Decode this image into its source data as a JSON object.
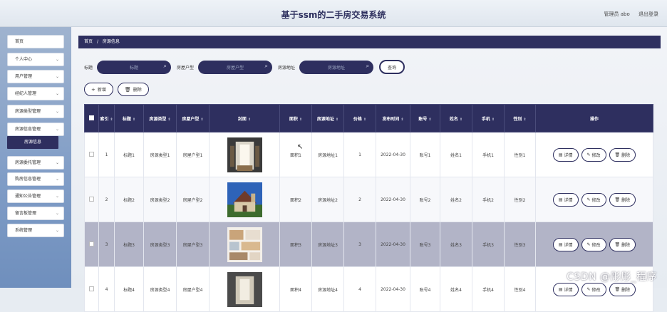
{
  "header": {
    "title": "基于ssm的二手房交易系统",
    "user": "管理员 abo",
    "logout": "退出登录"
  },
  "sidebar": {
    "items": [
      {
        "label": "首页",
        "chevron": false
      },
      {
        "label": "个人中心",
        "chevron": true
      },
      {
        "label": "用户管理",
        "chevron": true
      },
      {
        "label": "经纪人管理",
        "chevron": true
      },
      {
        "label": "房源类型管理",
        "chevron": true
      },
      {
        "label": "房源信息管理",
        "chevron": true
      },
      {
        "label": "房源委托管理",
        "chevron": true
      },
      {
        "label": "购房信息管理",
        "chevron": true
      },
      {
        "label": "通知公告管理",
        "chevron": true
      },
      {
        "label": "留言板管理",
        "chevron": true
      },
      {
        "label": "系统管理",
        "chevron": true
      }
    ],
    "active_sub": "房源信息"
  },
  "breadcrumb": {
    "home": "首页",
    "sep": "/",
    "current": "房源信息"
  },
  "search": {
    "fields": [
      {
        "label": "标题",
        "placeholder": "标题"
      },
      {
        "label": "房屋户型",
        "placeholder": "房屋户型"
      },
      {
        "label": "房源地址",
        "placeholder": "房源地址"
      }
    ],
    "query_button": "查询"
  },
  "actions": {
    "add": "新增",
    "delete": "删除"
  },
  "table": {
    "columns": [
      "索引",
      "标题",
      "房源类型",
      "房屋户型",
      "封面",
      "面积",
      "房源地址",
      "价格",
      "发布时间",
      "账号",
      "姓名",
      "手机",
      "性别",
      "操作"
    ],
    "rows": [
      {
        "index": "1",
        "title": "标题1",
        "type": "房源类型1",
        "layout": "房屋户型1",
        "area": "面积1",
        "address": "房源地址1",
        "price": "1",
        "time": "2022-04-30",
        "account": "账号1",
        "name": "姓名1",
        "phone": "手机1",
        "gender": "性别1"
      },
      {
        "index": "2",
        "title": "标题2",
        "type": "房源类型2",
        "layout": "房屋户型2",
        "area": "面积2",
        "address": "房源地址2",
        "price": "2",
        "time": "2022-04-30",
        "account": "账号2",
        "name": "姓名2",
        "phone": "手机2",
        "gender": "性别2"
      },
      {
        "index": "3",
        "title": "标题3",
        "type": "房源类型3",
        "layout": "房屋户型3",
        "area": "面积3",
        "address": "房源地址3",
        "price": "3",
        "time": "2022-04-30",
        "account": "账号3",
        "name": "姓名3",
        "phone": "手机3",
        "gender": "性别3"
      },
      {
        "index": "4",
        "title": "标题4",
        "type": "房源类型4",
        "layout": "房屋户型4",
        "area": "面积4",
        "address": "房源地址4",
        "price": "4",
        "time": "2022-04-30",
        "account": "账号4",
        "name": "姓名4",
        "phone": "手机4",
        "gender": "性别4"
      }
    ],
    "row_buttons": {
      "detail": "详情",
      "edit": "修改",
      "delete": "删除"
    }
  },
  "watermark": "CSDN @彤彤_程序",
  "colors": {
    "primary": "#2e2f5f",
    "sidebar": "#8aa3c9",
    "selected_row": "#b2b4c7"
  }
}
